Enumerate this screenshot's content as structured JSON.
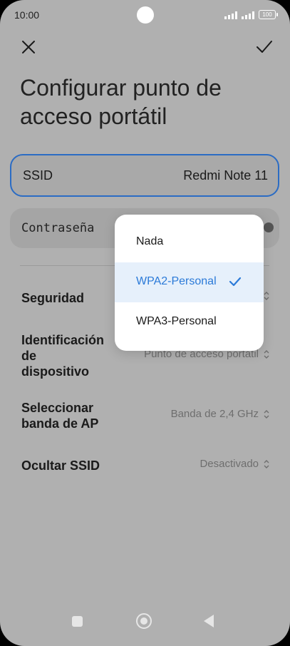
{
  "status_bar": {
    "time": "10:00",
    "battery": "100"
  },
  "header": {
    "title": "Configurar punto de acceso portátil"
  },
  "ssid": {
    "label": "SSID",
    "value": "Redmi Note 11"
  },
  "password": {
    "label": "Contraseña"
  },
  "settings": {
    "security": {
      "label": "Seguridad"
    },
    "device_id": {
      "label": "Identificación de dispositivo",
      "value": "Punto de acceso portátil"
    },
    "ap_band": {
      "label": "Seleccionar banda de AP",
      "value": "Banda de 2,4 GHz"
    },
    "hide_ssid": {
      "label": "Ocultar SSID",
      "value": "Desactivado"
    }
  },
  "security_menu": {
    "options": [
      "Nada",
      "WPA2-Personal",
      "WPA3-Personal"
    ],
    "selected": "WPA2-Personal"
  },
  "colors": {
    "accent": "#2b7ad8",
    "ssid_border": "#2b6cc4",
    "background": "#b0b0b0"
  }
}
